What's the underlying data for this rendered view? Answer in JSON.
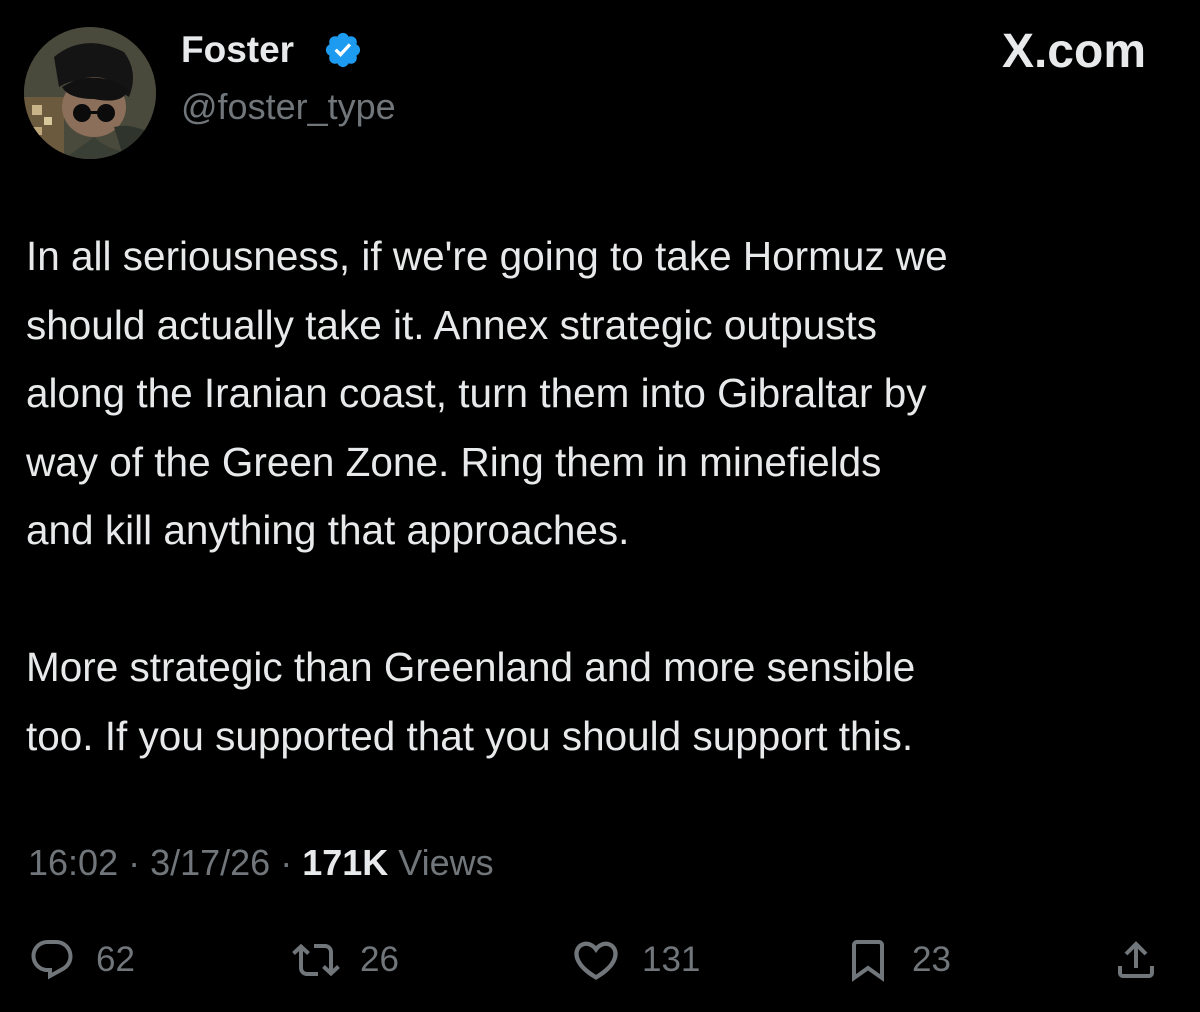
{
  "author": {
    "display_name": "Foster",
    "handle": "@foster_type",
    "verified": true,
    "avatar_icon": "profile-avatar"
  },
  "brand": "X.com",
  "tweet": {
    "paragraphs": [
      "In all seriousness, if we're going to take Hormuz we\nshould actually take it. Annex strategic outpusts\nalong the Iranian coast, turn them into Gibraltar by\nway of the Green Zone. Ring them in minefields\nand kill anything that approaches.",
      "More strategic than Greenland and more sensible\ntoo. If you supported that you should support this."
    ],
    "time": "16:02",
    "separator": " · ",
    "date": "3/17/26",
    "views_count": "171K",
    "views_label": " Views"
  },
  "actions": {
    "reply": {
      "icon": "reply-icon",
      "count": "62"
    },
    "retweet": {
      "icon": "retweet-icon",
      "count": "26"
    },
    "like": {
      "icon": "heart-icon",
      "count": "131"
    },
    "bookmark": {
      "icon": "bookmark-icon",
      "count": "23"
    },
    "share": {
      "icon": "share-icon"
    }
  },
  "colors": {
    "background": "#000000",
    "primary_text": "#e7e9ea",
    "secondary_text": "#71767b",
    "verified_blue": "#1d9bf0"
  }
}
